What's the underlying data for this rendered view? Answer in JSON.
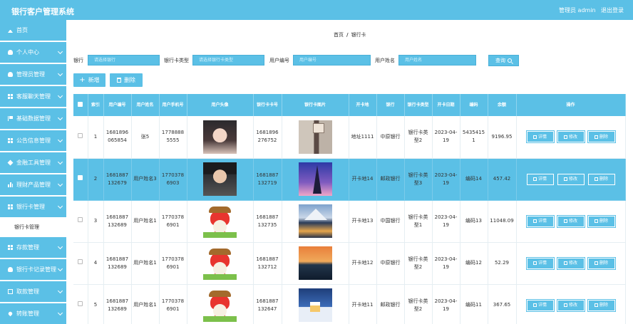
{
  "header": {
    "title": "银行客户管理系统",
    "user": "管理员 admin",
    "logout": "退出登录"
  },
  "sidebar": {
    "items": [
      {
        "label": "首页",
        "icon": "home-icon",
        "expandable": false
      },
      {
        "label": "个人中心",
        "icon": "user-icon",
        "expandable": true
      },
      {
        "label": "管理员管理",
        "icon": "user-icon",
        "expandable": true
      },
      {
        "label": "客服聊天管理",
        "icon": "grid-icon",
        "expandable": true
      },
      {
        "label": "基础数据管理",
        "icon": "flag-icon",
        "expandable": true
      },
      {
        "label": "公告信息管理",
        "icon": "grid-icon",
        "expandable": true
      },
      {
        "label": "金融工具管理",
        "icon": "cube-icon",
        "expandable": true
      },
      {
        "label": "理财产品管理",
        "icon": "bar-icon",
        "expandable": true
      },
      {
        "label": "银行卡管理",
        "icon": "grid-icon",
        "expandable": true
      },
      {
        "label": "存款管理",
        "icon": "grid-icon",
        "expandable": true
      },
      {
        "label": "银行卡记录管理",
        "icon": "user-icon",
        "expandable": true
      },
      {
        "label": "取款管理",
        "icon": "sheet-icon",
        "expandable": true
      },
      {
        "label": "转账管理",
        "icon": "heart-icon",
        "expandable": true
      }
    ],
    "subitem": "银行卡管理"
  },
  "breadcrumb": {
    "home": "首页",
    "sep": "/",
    "current": "银行卡"
  },
  "search": {
    "bank_label": "银行",
    "bank_placeholder": "请选择银行",
    "cardtype_label": "银行卡类型",
    "cardtype_placeholder": "请选择银行卡类型",
    "userno_label": "用户编号",
    "userno_placeholder": "用户编号",
    "username_label": "用户姓名",
    "username_placeholder": "用户姓名",
    "query_label": "查询"
  },
  "actions": {
    "add": "新增",
    "delete": "删除"
  },
  "table": {
    "headers": [
      "",
      "索引",
      "用户编号",
      "用户姓名",
      "用户手机号",
      "用户头像",
      "银行卡卡号",
      "银行卡图片",
      "开卡地",
      "银行",
      "银行卡类型",
      "开卡日期",
      "编码",
      "余额",
      "操作"
    ],
    "ops": {
      "detail": "详情",
      "edit": "修改",
      "delete": "删除"
    },
    "rows": [
      {
        "index": "1",
        "user_no": "1681896065854",
        "name": "张5",
        "phone": "17788885555",
        "avatar": "girl",
        "card_no": "1681896276752",
        "pic": "room",
        "place": "地址1111",
        "bank": "中原银行",
        "type": "银行卡类型2",
        "date": "2023-04-19",
        "code": "54354151",
        "balance": "9196.95",
        "selected": false
      },
      {
        "index": "2",
        "user_no": "1681887132679",
        "name": "用户姓名3",
        "phone": "17703786903",
        "avatar": "boy",
        "card_no": "1681887132719",
        "pic": "tower",
        "place": "开卡地14",
        "bank": "邮政银行",
        "type": "银行卡类型3",
        "date": "2023-04-19",
        "code": "编码14",
        "balance": "457.42",
        "selected": true
      },
      {
        "index": "3",
        "user_no": "1681887132689",
        "name": "用户姓名1",
        "phone": "17703786901",
        "avatar": "fox",
        "card_no": "1681887132735",
        "pic": "fuji",
        "place": "开卡地13",
        "bank": "中国银行",
        "type": "银行卡类型1",
        "date": "2023-04-19",
        "code": "编码13",
        "balance": "11048.09",
        "selected": false
      },
      {
        "index": "4",
        "user_no": "1681887132689",
        "name": "用户姓名1",
        "phone": "17703786901",
        "avatar": "fox",
        "card_no": "1681887132712",
        "pic": "sunset",
        "place": "开卡地12",
        "bank": "中原银行",
        "type": "银行卡类型2",
        "date": "2023-04-19",
        "code": "编码12",
        "balance": "52.29",
        "selected": false
      },
      {
        "index": "5",
        "user_no": "1681887132689",
        "name": "用户姓名1",
        "phone": "17703786901",
        "avatar": "fox",
        "card_no": "1681887132647",
        "pic": "snow",
        "place": "开卡地11",
        "bank": "邮政银行",
        "type": "银行卡类型2",
        "date": "2023-04-19",
        "code": "编码11",
        "balance": "367.65",
        "selected": false
      }
    ]
  },
  "colors": {
    "accent": "#5bc0e6"
  }
}
